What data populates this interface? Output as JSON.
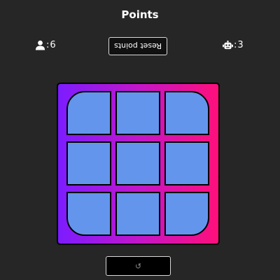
{
  "header": {
    "title": "Points"
  },
  "scores": {
    "player": {
      "icon": "user-icon",
      "separator": ":",
      "value": "6"
    },
    "bot": {
      "icon": "robot-icon",
      "separator": ":",
      "value": "3"
    }
  },
  "reset": {
    "label": "Reset points"
  },
  "board": {
    "cells": [
      "",
      "",
      "",
      "",
      "",
      "",
      "",
      "",
      ""
    ],
    "colors": {
      "gradient_start": "#7c1cff",
      "gradient_end": "#ff0f7a",
      "cell": "#6495ed",
      "border": "#000000"
    }
  },
  "restart": {
    "icon": "restart-icon",
    "label": "↺"
  }
}
